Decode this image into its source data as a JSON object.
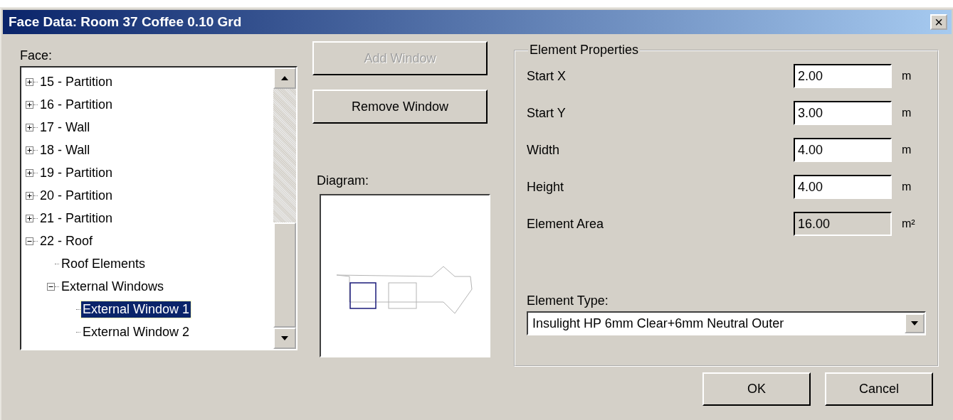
{
  "window": {
    "title": "Face Data: Room 37  Coffee 0.10 Grd",
    "close": "×"
  },
  "face_tree": {
    "label": "Face:",
    "items": [
      {
        "label": "15 - Partition",
        "expanded": false,
        "selected": false
      },
      {
        "label": "16 - Partition",
        "expanded": false,
        "selected": false
      },
      {
        "label": "17 - Wall",
        "expanded": false,
        "selected": false
      },
      {
        "label": "18 - Wall",
        "expanded": false,
        "selected": false
      },
      {
        "label": "19 - Partition",
        "expanded": false,
        "selected": false
      },
      {
        "label": "20 - Partition",
        "expanded": false,
        "selected": false
      },
      {
        "label": "21 - Partition",
        "expanded": false,
        "selected": false
      },
      {
        "label": "22 - Roof",
        "expanded": true,
        "selected": false,
        "children": [
          {
            "label": "Roof Elements",
            "selected": false
          },
          {
            "label": "External Windows",
            "expanded": true,
            "selected": false,
            "children": [
              {
                "label": "External Window 1",
                "selected": true
              },
              {
                "label": "External Window 2",
                "selected": false
              }
            ]
          }
        ]
      }
    ]
  },
  "buttons": [
    {
      "label": "Add Window",
      "disabled": true
    },
    {
      "label": "Remove Window",
      "disabled": false
    }
  ],
  "diagram": {
    "label": "Diagram:"
  },
  "element_properties": {
    "title": "Element Properties",
    "fields": [
      {
        "label": "Start X",
        "value": "2.00",
        "unit": "m",
        "disabled": false
      },
      {
        "label": "Start Y",
        "value": "3.00",
        "unit": "m",
        "disabled": false
      },
      {
        "label": "Width",
        "value": "4.00",
        "unit": "m",
        "disabled": false
      },
      {
        "label": "Height",
        "value": "4.00",
        "unit": "m",
        "disabled": false
      },
      {
        "label": "Element Area",
        "value": "16.00",
        "unit": "m²",
        "disabled": true
      }
    ],
    "element_type": {
      "label": "Element Type:",
      "value": "Insulight HP 6mm Clear+6mm Neutral Outer"
    }
  },
  "dialog_buttons": [
    {
      "label": "OK"
    },
    {
      "label": "Cancel"
    }
  ]
}
